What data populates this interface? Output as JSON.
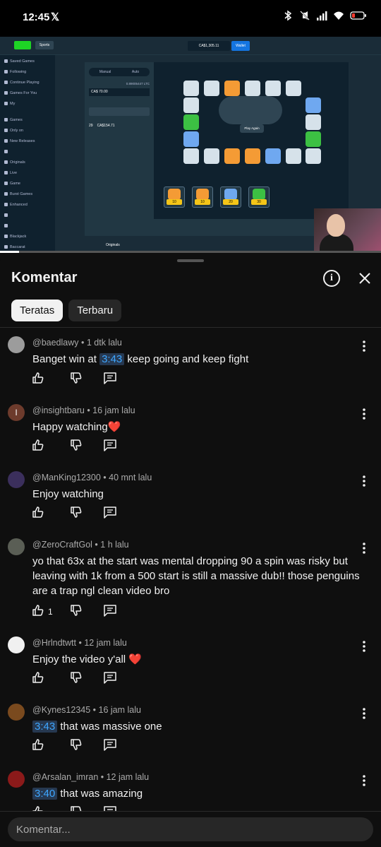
{
  "status_bar": {
    "time": "12:45",
    "app_badge": "𝕏",
    "icons": [
      "bluetooth-icon",
      "mute-vibrate-icon",
      "signal-icon",
      "wifi-icon",
      "battery-low-icon"
    ]
  },
  "video": {
    "progress": 0.05,
    "labels": {
      "sports": "Sports",
      "balance": "CA$1,305.11",
      "wallet": "Wallet",
      "sidebar": [
        "Saved Games",
        "Following",
        "Continue Playing",
        "Games For You",
        "My",
        "Games",
        "Only on",
        "New Releases",
        "",
        "Originals",
        "Live",
        "Game",
        "Burst Games",
        "Enhanced",
        "",
        "",
        "Blackjack",
        "Baccarat"
      ],
      "panel_tabs": [
        "Manual",
        "Auto"
      ],
      "bet_amount": "CA$ 70.00",
      "rate": "0.89005447 LTC",
      "cashout": "CA$154.71",
      "round": "29",
      "play_again": "Play Again",
      "bottom_tiles": [
        "10",
        "10",
        "20",
        "30"
      ],
      "originals": "Originals"
    }
  },
  "sheet": {
    "title": "Komentar",
    "chips": [
      {
        "label": "Teratas",
        "active": true
      },
      {
        "label": "Terbaru",
        "active": false
      }
    ],
    "comments": [
      {
        "author": "@baedlawy",
        "time": "1 dtk lalu",
        "parts": [
          {
            "t": "Banget win at "
          },
          {
            "ts": "3:43"
          },
          {
            "t": " keep going and keep fight"
          }
        ],
        "likes": "",
        "avatar_color": "#9c9c9c"
      },
      {
        "author": "@insightbaru",
        "time": "16 jam lalu",
        "parts": [
          {
            "t": "Happy watching"
          },
          {
            "heart": "❤️"
          }
        ],
        "likes": "",
        "avatar_color": "#6d3b2c",
        "avatar_letter": "I"
      },
      {
        "author": "@ManKing12300",
        "time": "40 mnt lalu",
        "parts": [
          {
            "t": "Enjoy watching"
          }
        ],
        "likes": "",
        "avatar_color": "#3b2f5c"
      },
      {
        "author": "@ZeroCraftGol",
        "time": "1 h lalu",
        "parts": [
          {
            "t": "yo that 63x at the start was mental dropping 90 a spin was risky but leaving with 1k from a 500 start is still a massive dub!! those penguins are a trap ngl clean video bro"
          }
        ],
        "likes": "1",
        "avatar_color": "#5a5e55"
      },
      {
        "author": "@Hrlndtwtt",
        "time": "12 jam lalu",
        "parts": [
          {
            "t": "Enjoy the video y'all "
          },
          {
            "heart": "❤️"
          }
        ],
        "likes": "",
        "avatar_color": "#f0f0f0"
      },
      {
        "author": "@Kynes12345",
        "time": "16 jam lalu",
        "parts": [
          {
            "ts": "3:43"
          },
          {
            "t": " that was massive one"
          }
        ],
        "likes": "",
        "avatar_color": "#7a4a1e"
      },
      {
        "author": "@Arsalan_imran",
        "time": "12 jam lalu",
        "parts": [
          {
            "ts": "3:40"
          },
          {
            "t": " that was amazing"
          }
        ],
        "likes": "",
        "avatar_color": "#8b1a1a"
      }
    ],
    "input_placeholder": "Komentar..."
  }
}
